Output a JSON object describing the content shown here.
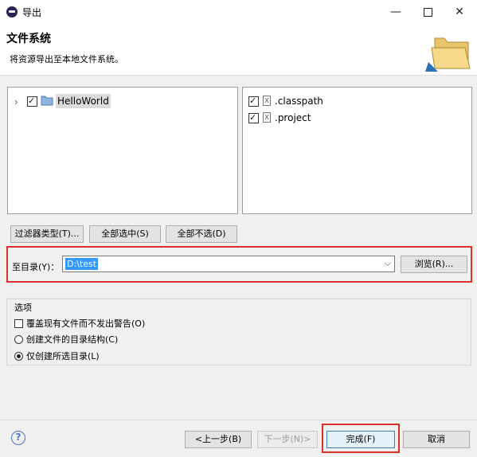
{
  "window": {
    "title": "导出",
    "minimize": "—",
    "close": "✕"
  },
  "header": {
    "title": "文件系统",
    "description": "将资源导出至本地文件系统。"
  },
  "tree": {
    "items": [
      {
        "label": "HelloWorld",
        "checked": true,
        "expanded": false
      }
    ]
  },
  "files": {
    "items": [
      {
        "label": ".classpath",
        "checked": true
      },
      {
        "label": ".project",
        "checked": true
      }
    ]
  },
  "buttons": {
    "filter": "过滤器类型(T)...",
    "select_all": "全部选中(S)",
    "deselect_all": "全部不选(D)",
    "browse": "浏览(R)..."
  },
  "destination": {
    "label": "至目录(Y)：",
    "value": "D:\\test"
  },
  "options": {
    "legend": "选项",
    "overwrite": "覆盖现有文件而不发出警告(O)",
    "create_structure": "创建文件的目录结构(C)",
    "create_selected": "仅创建所选目录(L)",
    "selected_option": "create_selected"
  },
  "footer": {
    "help": "?",
    "back": "<上一步(B)",
    "next": "下一步(N)>",
    "finish": "完成(F)",
    "cancel": "取消"
  },
  "colors": {
    "highlight_box": "#d9302c",
    "selection": "#3399ff"
  }
}
